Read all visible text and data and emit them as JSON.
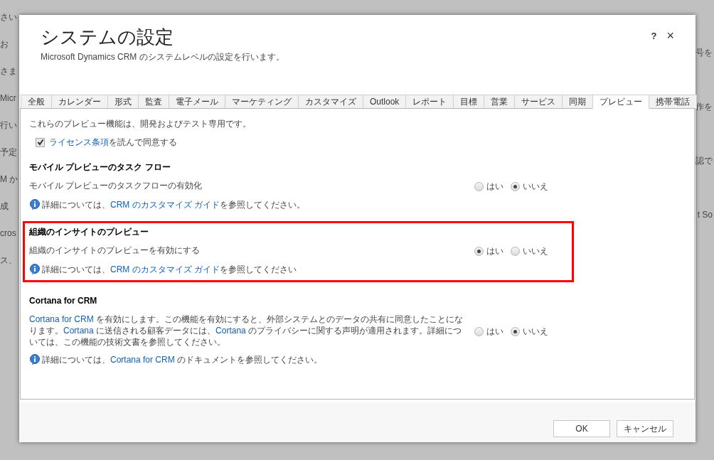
{
  "background": {
    "left": [
      "さい",
      "お",
      "さま",
      "Micr",
      "行い",
      "予定",
      "M か",
      "成",
      "cros",
      "ス、"
    ],
    "right": [
      "号を",
      "作を",
      "認で",
      "t So"
    ]
  },
  "dialog": {
    "title": "システムの設定",
    "subtitle": "Microsoft Dynamics CRM のシステムレベルの設定を行います。",
    "help": "?",
    "close": "×"
  },
  "tabs": [
    {
      "label": "全般",
      "selected": false
    },
    {
      "label": "カレンダー",
      "selected": false
    },
    {
      "label": "形式",
      "selected": false
    },
    {
      "label": "監査",
      "selected": false
    },
    {
      "label": "電子メール",
      "selected": false
    },
    {
      "label": "マーケティング",
      "selected": false
    },
    {
      "label": "カスタマイズ",
      "selected": false
    },
    {
      "label": "Outlook",
      "selected": false
    },
    {
      "label": "レポート",
      "selected": false
    },
    {
      "label": "目標",
      "selected": false
    },
    {
      "label": "営業",
      "selected": false
    },
    {
      "label": "サービス",
      "selected": false
    },
    {
      "label": "同期",
      "selected": false
    },
    {
      "label": "プレビュー",
      "selected": true
    },
    {
      "label": "携帯電話",
      "selected": false
    }
  ],
  "intro": "これらのプレビュー機能は、開発およびテスト専用です。",
  "license": {
    "checked": true,
    "link": "ライセンス条項",
    "text": "を読んで同意する"
  },
  "sections": [
    {
      "title": "モバイル プレビューのタスク フロー",
      "highlighted": false,
      "description": [
        {
          "text": "モバイル プレビューのタスクフローの有効化",
          "link": false
        }
      ],
      "options": [
        {
          "label": "はい",
          "selected": false
        },
        {
          "label": "いいえ",
          "selected": true
        }
      ],
      "info": {
        "before": "詳細については、",
        "link": "CRM のカスタマイズ ガイド",
        "after": "を参照してください。"
      }
    },
    {
      "title": "組織のインサイトのプレビュー",
      "highlighted": true,
      "description": [
        {
          "text": "組織のインサイトのプレビューを有効にする",
          "link": false
        }
      ],
      "options": [
        {
          "label": "はい",
          "selected": true
        },
        {
          "label": "いいえ",
          "selected": false
        }
      ],
      "info": {
        "before": "詳細については、",
        "link": "CRM のカスタマイズ ガイド",
        "after": "を参照してください"
      }
    },
    {
      "title": "Cortana for CRM",
      "highlighted": false,
      "description": [
        {
          "text": "Cortana for CRM",
          "link": true
        },
        {
          "text": " を有効にします。この機能を有効にすると、外部システムとのデータの共有に同意したことになります。",
          "link": false
        },
        {
          "text": "Cortana",
          "link": true
        },
        {
          "text": " に送信される顧客データには、",
          "link": false
        },
        {
          "text": "Cortana",
          "link": true
        },
        {
          "text": " のプライバシーに関する声明が適用されます。詳細については、この機能の技術文書を参照してください。",
          "link": false
        }
      ],
      "options": [
        {
          "label": "はい",
          "selected": false
        },
        {
          "label": "いいえ",
          "selected": true
        }
      ],
      "info": {
        "before": "詳細については、",
        "link": "Cortana for CRM",
        "after": " のドキュメントを参照してください。"
      }
    }
  ],
  "buttons": [
    "OK",
    "キャンセル"
  ]
}
